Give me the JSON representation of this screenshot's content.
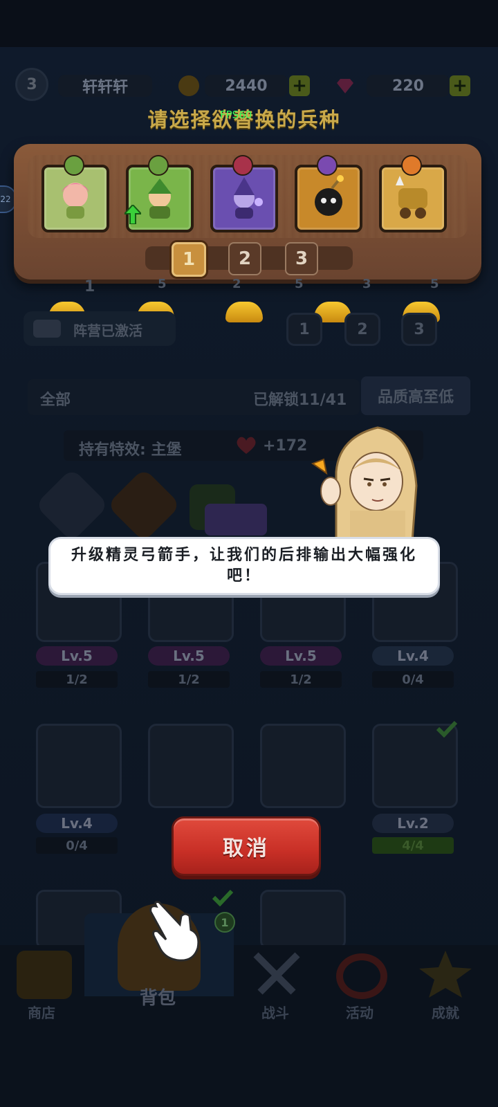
{
  "top": {
    "level": "3",
    "player_name": "轩轩轩",
    "gold": "2440",
    "gems": "220",
    "plus": "+"
  },
  "dialog_title": "请选择欲替换的兵种",
  "fps": "FPS60",
  "side_badge": "22",
  "swap_panel": {
    "units": [
      {
        "name": "archer-girl",
        "color": "#a8c070"
      },
      {
        "name": "elf-archer",
        "color": "#7ab54a"
      },
      {
        "name": "wizard",
        "color": "#6a4fb0"
      },
      {
        "name": "bomber",
        "color": "#c8892a"
      },
      {
        "name": "cannon",
        "color": "#d9a848"
      }
    ],
    "pages": [
      "1",
      "2",
      "3"
    ],
    "active_page": "1"
  },
  "background": {
    "activated_label": "阵营已激活",
    "slot_numbers": [
      "1",
      "5",
      "2",
      "5",
      "3",
      "5"
    ],
    "formation_tabs": [
      "1",
      "2",
      "3"
    ],
    "filter_all": "全部",
    "unlocked": "已解锁11/41",
    "sort": "品质高至低",
    "effect_label": "持有特效: 主堡",
    "effect_value": "+172",
    "row1": [
      {
        "lv": "Lv.5",
        "prog": "1/2"
      },
      {
        "lv": "Lv.5",
        "prog": "1/2"
      },
      {
        "lv": "Lv.5",
        "prog": "1/2"
      },
      {
        "lv": "Lv.4",
        "prog": "0/4"
      }
    ],
    "row2": [
      {
        "lv": "Lv.4",
        "prog": "0/4"
      },
      {
        "lv": "",
        "prog": ""
      },
      {
        "lv": "",
        "prog": ""
      },
      {
        "lv": "Lv.2",
        "prog": "4/4"
      }
    ]
  },
  "tutorial_text": "升级精灵弓箭手，让我们的后排输出大幅强化吧！",
  "cancel_label": "取消",
  "badge_count": "1",
  "bottom_nav": [
    {
      "label": "商店"
    },
    {
      "label": "背包"
    },
    {
      "label": "战斗"
    },
    {
      "label": "活动"
    },
    {
      "label": "成就"
    }
  ]
}
